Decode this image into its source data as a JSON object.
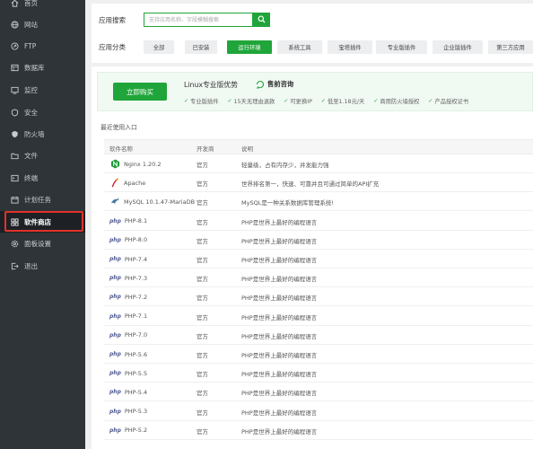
{
  "sidebar": {
    "items": [
      {
        "label": "首页",
        "icon": "home-icon"
      },
      {
        "label": "网站",
        "icon": "globe-icon"
      },
      {
        "label": "FTP",
        "icon": "ftp-icon"
      },
      {
        "label": "数据库",
        "icon": "database-icon"
      },
      {
        "label": "监控",
        "icon": "monitor-icon"
      },
      {
        "label": "安全",
        "icon": "shield-icon"
      },
      {
        "label": "防火墙",
        "icon": "firewall-icon"
      },
      {
        "label": "文件",
        "icon": "folder-icon"
      },
      {
        "label": "终端",
        "icon": "terminal-icon"
      },
      {
        "label": "计划任务",
        "icon": "calendar-icon"
      },
      {
        "label": "软件商店",
        "icon": "grid-icon"
      },
      {
        "label": "面板设置",
        "icon": "gear-icon"
      },
      {
        "label": "退出",
        "icon": "logout-icon"
      }
    ],
    "active_index": 10
  },
  "search": {
    "label": "应用搜索",
    "placeholder": "支持应用名称、字段模糊搜索"
  },
  "categories": {
    "label": "应用分类",
    "items": [
      "全部",
      "已安装",
      "运行环境",
      "系统工具",
      "宝塔插件",
      "专业版插件",
      "企业版插件",
      "第三方应用"
    ],
    "active_index": 2
  },
  "promo": {
    "buy_label": "立即购买",
    "title": "Linux专业版优势",
    "consult": "售前咨询",
    "features": [
      "专业版插件",
      "15天无理由退款",
      "可更换IP",
      "低至1.18元/天",
      "商用防火墙授权",
      "产品授权证书"
    ]
  },
  "recent_label": "最近使用入口",
  "table": {
    "headers": [
      "软件名称",
      "开发商",
      "说明"
    ],
    "rows": [
      {
        "name": "Nginx 1.20.2",
        "vendor": "官方",
        "desc": "轻量级，占有内存少，并发能力强",
        "icon": "nginx-icon"
      },
      {
        "name": "Apache",
        "vendor": "官方",
        "desc": "世界排名第一，快速、可靠并且可通过简单的API扩充",
        "icon": "apache-icon"
      },
      {
        "name": "MySQL 10.1.47-MariaDB",
        "vendor": "官方",
        "desc": "MySQL是一种关系数据库管理系统!",
        "icon": "mysql-icon"
      },
      {
        "name": "PHP-8.1",
        "vendor": "官方",
        "desc": "PHP是世界上最好的编程语言",
        "icon": "php-icon"
      },
      {
        "name": "PHP-8.0",
        "vendor": "官方",
        "desc": "PHP是世界上最好的编程语言",
        "icon": "php-icon"
      },
      {
        "name": "PHP-7.4",
        "vendor": "官方",
        "desc": "PHP是世界上最好的编程语言",
        "icon": "php-icon"
      },
      {
        "name": "PHP-7.3",
        "vendor": "官方",
        "desc": "PHP是世界上最好的编程语言",
        "icon": "php-icon"
      },
      {
        "name": "PHP-7.2",
        "vendor": "官方",
        "desc": "PHP是世界上最好的编程语言",
        "icon": "php-icon"
      },
      {
        "name": "PHP-7.1",
        "vendor": "官方",
        "desc": "PHP是世界上最好的编程语言",
        "icon": "php-icon"
      },
      {
        "name": "PHP-7.0",
        "vendor": "官方",
        "desc": "PHP是世界上最好的编程语言",
        "icon": "php-icon"
      },
      {
        "name": "PHP-5.6",
        "vendor": "官方",
        "desc": "PHP是世界上最好的编程语言",
        "icon": "php-icon"
      },
      {
        "name": "PHP-5.5",
        "vendor": "官方",
        "desc": "PHP是世界上最好的编程语言",
        "icon": "php-icon"
      },
      {
        "name": "PHP-5.4",
        "vendor": "官方",
        "desc": "PHP是世界上最好的编程语言",
        "icon": "php-icon"
      },
      {
        "name": "PHP-5.3",
        "vendor": "官方",
        "desc": "PHP是世界上最好的编程语言",
        "icon": "php-icon"
      },
      {
        "name": "PHP-5.2",
        "vendor": "官方",
        "desc": "PHP是世界上最好的编程语言",
        "icon": "php-icon"
      }
    ]
  },
  "colors": {
    "accent": "#20a53a",
    "sidebar_bg": "#2f3439",
    "highlight": "#e0332a"
  }
}
